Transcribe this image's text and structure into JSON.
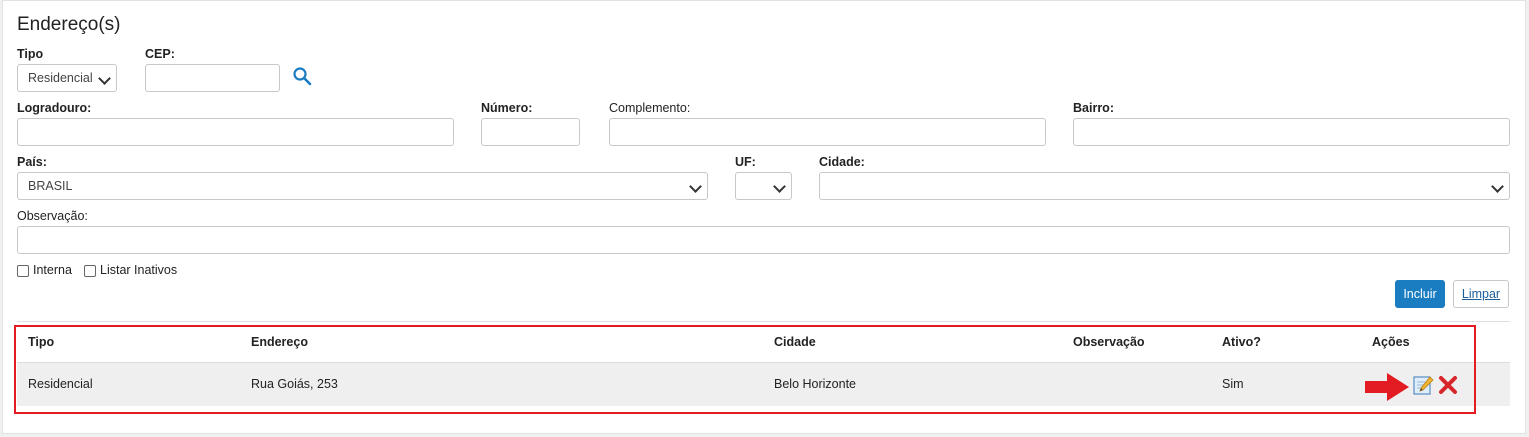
{
  "section_title": "Endereço(s)",
  "form": {
    "tipo": {
      "label": "Tipo",
      "value": "Residencial"
    },
    "cep": {
      "label": "CEP:",
      "value": ""
    },
    "logradouro": {
      "label": "Logradouro:",
      "value": ""
    },
    "numero": {
      "label": "Número:",
      "value": ""
    },
    "complemento": {
      "label": "Complemento:",
      "value": ""
    },
    "bairro": {
      "label": "Bairro:",
      "value": ""
    },
    "pais": {
      "label": "País:",
      "value": "BRASIL"
    },
    "uf": {
      "label": "UF:",
      "value": ""
    },
    "cidade": {
      "label": "Cidade:",
      "value": ""
    },
    "observacao": {
      "label": "Observação:",
      "value": ""
    },
    "interna_label": "Interna",
    "listar_inativos_label": "Listar Inativos"
  },
  "buttons": {
    "incluir": "Incluir",
    "limpar": "Limpar"
  },
  "table": {
    "headers": [
      "Tipo",
      "Endereço",
      "Cidade",
      "Observação",
      "Ativo?",
      "Ações"
    ],
    "rows": [
      {
        "tipo": "Residencial",
        "endereco": "Rua Goiás, 253",
        "cidade": "Belo Horizonte",
        "observacao": "",
        "ativo": "Sim"
      }
    ]
  },
  "icons": {
    "search": "search-icon",
    "edit": "edit-icon",
    "delete": "delete-icon",
    "arrow": "arrow-right-icon"
  },
  "colors": {
    "primary": "#1a7cc1",
    "highlight": "#e31b23"
  }
}
